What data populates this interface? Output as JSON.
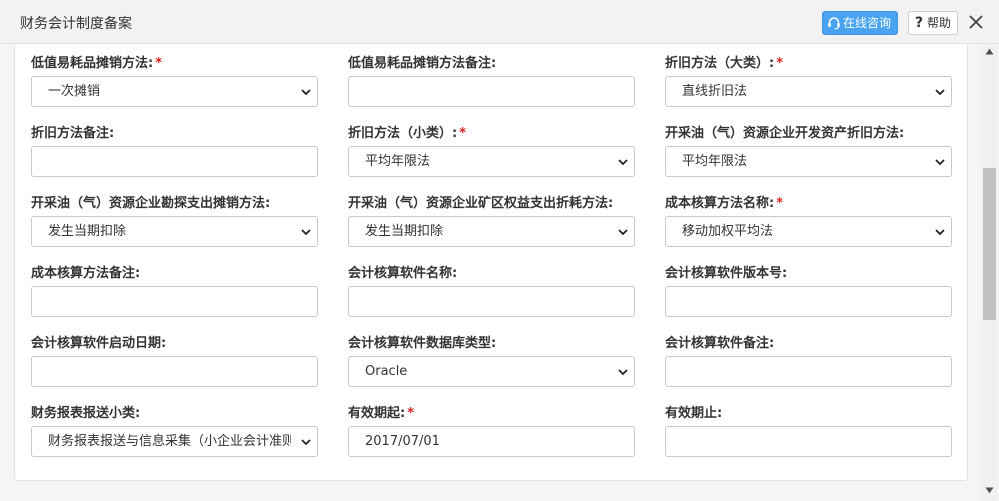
{
  "dialog": {
    "title": "财务会计制度备案",
    "consult_label": "在线咨询",
    "help_label": "帮助"
  },
  "form": {
    "fields": [
      {
        "label": "低值易耗品摊销方法:",
        "required": true,
        "type": "select",
        "value": "一次摊销"
      },
      {
        "label": "低值易耗品摊销方法备注:",
        "required": false,
        "type": "input",
        "value": ""
      },
      {
        "label": "折旧方法（大类）:",
        "required": true,
        "type": "select",
        "value": "直线折旧法"
      },
      {
        "label": "折旧方法备注:",
        "required": false,
        "type": "input",
        "value": ""
      },
      {
        "label": "折旧方法（小类）:",
        "required": true,
        "type": "select",
        "value": "平均年限法"
      },
      {
        "label": "开采油（气）资源企业开发资产折旧方法:",
        "required": false,
        "type": "select",
        "value": "平均年限法"
      },
      {
        "label": "开采油（气）资源企业勘探支出摊销方法:",
        "required": false,
        "type": "select",
        "value": "发生当期扣除"
      },
      {
        "label": "开采油（气）资源企业矿区权益支出折耗方法:",
        "required": false,
        "type": "select",
        "value": "发生当期扣除"
      },
      {
        "label": "成本核算方法名称:",
        "required": true,
        "type": "select",
        "value": "移动加权平均法"
      },
      {
        "label": "成本核算方法备注:",
        "required": false,
        "type": "input",
        "value": ""
      },
      {
        "label": "会计核算软件名称:",
        "required": false,
        "type": "input",
        "value": ""
      },
      {
        "label": "会计核算软件版本号:",
        "required": false,
        "type": "input",
        "value": ""
      },
      {
        "label": "会计核算软件启动日期:",
        "required": false,
        "type": "input",
        "value": ""
      },
      {
        "label": "会计核算软件数据库类型:",
        "required": false,
        "type": "select",
        "value": "Oracle"
      },
      {
        "label": "会计核算软件备注:",
        "required": false,
        "type": "input",
        "value": ""
      },
      {
        "label": "财务报表报送小类:",
        "required": false,
        "type": "select",
        "value": "财务报表报送与信息采集（小企业会计准则）"
      },
      {
        "label": "有效期起:",
        "required": true,
        "type": "input",
        "value": "2017/07/01"
      },
      {
        "label": "有效期止:",
        "required": false,
        "type": "input",
        "value": ""
      }
    ]
  },
  "colors": {
    "accent": "#4aa3f0",
    "required_mark": "#e02020"
  },
  "icons": {
    "consult": "headset-icon",
    "help": "question-icon",
    "close": "close-icon",
    "dropdown": "chevron-down-icon"
  }
}
